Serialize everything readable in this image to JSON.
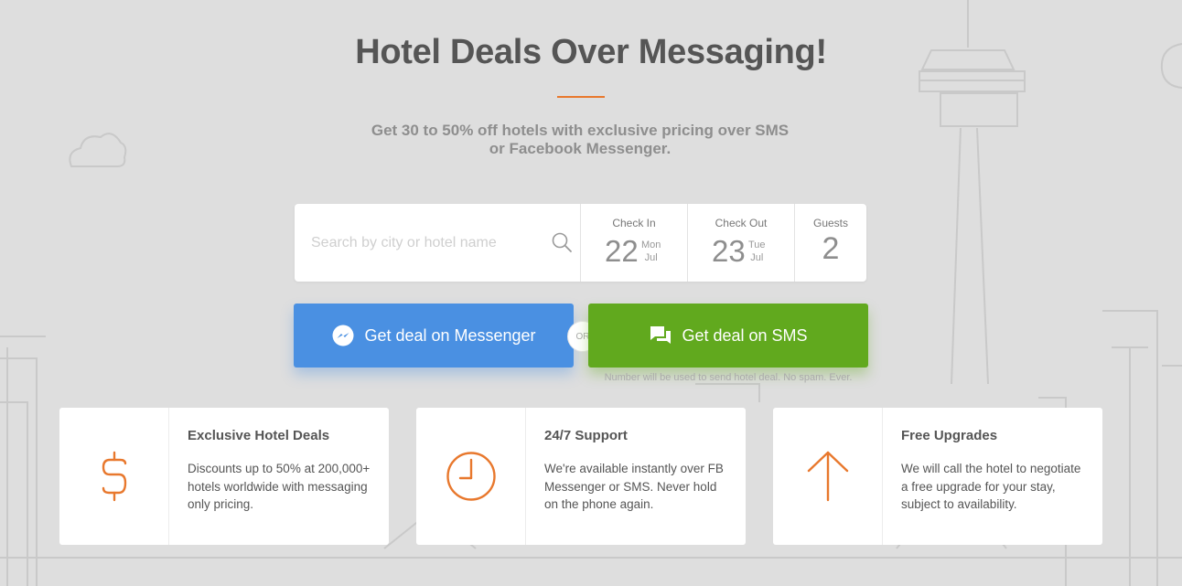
{
  "header": {
    "title": "Hotel Deals Over Messaging!",
    "subtitle": "Get 30 to 50% off hotels with exclusive pricing over SMS or Facebook Messenger."
  },
  "search": {
    "placeholder": "Search by city or hotel name",
    "value": "",
    "check_in": {
      "label": "Check In",
      "day": "22",
      "weekday": "Mon",
      "month": "Jul"
    },
    "check_out": {
      "label": "Check Out",
      "day": "23",
      "weekday": "Tue",
      "month": "Jul"
    },
    "guests": {
      "label": "Guests",
      "count": "2"
    }
  },
  "actions": {
    "messenger_label": "Get deal on Messenger",
    "or_label": "OR",
    "sms_label": "Get deal on SMS",
    "sms_note": "Number will be used to send hotel deal. No spam. Ever."
  },
  "features": [
    {
      "icon": "dollar-icon",
      "title": "Exclusive Hotel Deals",
      "desc": "Discounts up to 50% at 200,000+ hotels worldwide with messaging only pricing."
    },
    {
      "icon": "clock-icon",
      "title": "24/7 Support",
      "desc": "We're available instantly over FB Messenger or SMS. Never hold on the phone again."
    },
    {
      "icon": "arrow-up-icon",
      "title": "Free Upgrades",
      "desc": "We will call the hotel to negotiate a free upgrade for your stay, subject to availability."
    }
  ],
  "colors": {
    "background": "#dedede",
    "accent": "#e8782d",
    "messenger": "#4a90e2",
    "sms": "#61a91e"
  }
}
